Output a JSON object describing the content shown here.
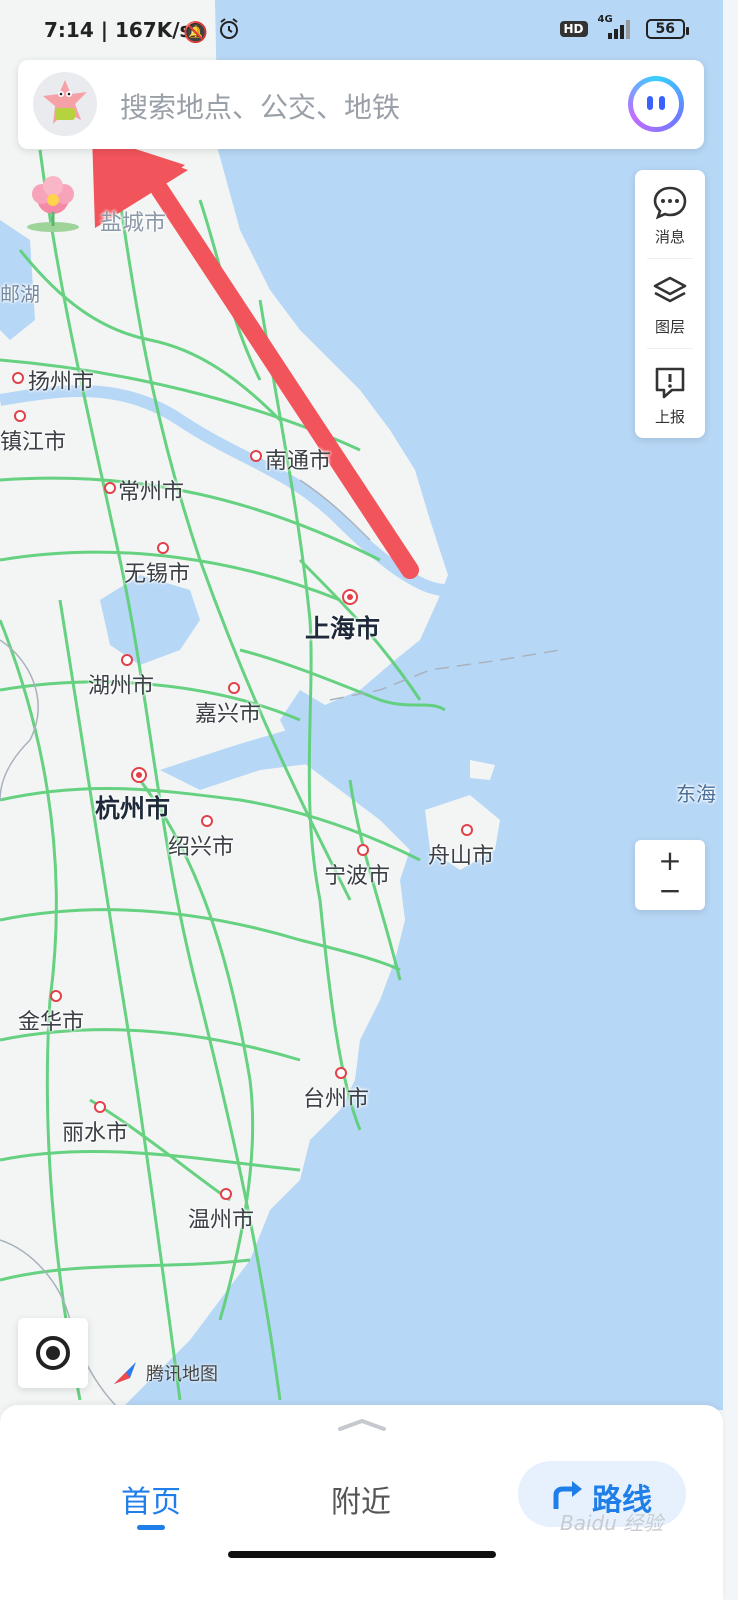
{
  "status_bar": {
    "time": "7:14 | 167K/s",
    "hd_badge": "HD",
    "network": "4G",
    "battery": "56"
  },
  "search": {
    "placeholder": "搜索地点、公交、地铁"
  },
  "side_panel": {
    "items": [
      {
        "label": "消息",
        "icon": "message-icon"
      },
      {
        "label": "图层",
        "icon": "layers-icon"
      },
      {
        "label": "上报",
        "icon": "report-icon"
      }
    ]
  },
  "zoom": {
    "in": "+",
    "out": "−"
  },
  "map": {
    "brand": "腾讯地图",
    "cities": {
      "shanghai": "上海市",
      "hangzhou": "杭州市",
      "yangzhou": "扬州市",
      "zhenjiang": "镇江市",
      "nantong": "南通市",
      "changzhou": "常州市",
      "wuxi": "无锡市",
      "huzhou": "湖州市",
      "jiaxing": "嘉兴市",
      "shaoxing": "绍兴市",
      "ningbo": "宁波市",
      "zhoushan": "舟山市",
      "jinhua": "金华市",
      "taizhou": "台州市",
      "lishui": "丽水市",
      "wenzhou": "温州市",
      "yancheng_partial": "盐城市",
      "gaoyou_partial": "邮湖"
    },
    "sea_label": "东海"
  },
  "bottom_nav": {
    "home": "首页",
    "nearby": "附近",
    "route": "路线"
  },
  "watermark": "Baidu 经验"
}
